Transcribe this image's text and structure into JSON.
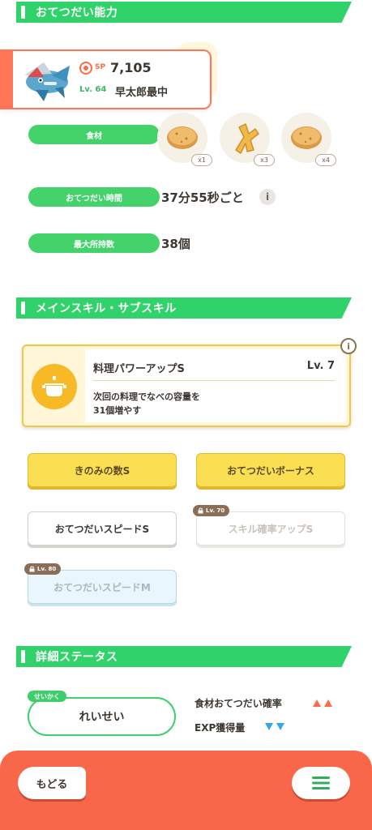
{
  "sections": {
    "ability": "おてつだい能力",
    "skills": "メインスキル・サブスキル",
    "status": "詳細ステータス"
  },
  "pokemon": {
    "sp_label": "SP",
    "sp_value": "7,105",
    "level": "Lv. 64",
    "nickname": "早太郎最中",
    "accent_color": "#ff7656"
  },
  "ability": {
    "ingredients_label": "食材",
    "ingredients": [
      {
        "icon": "potato-icon",
        "count": "x1"
      },
      {
        "icon": "ginger-icon",
        "count": "x3"
      },
      {
        "icon": "potato-icon",
        "count": "x4"
      }
    ],
    "help_time_label": "おてつだい時間",
    "help_time_value": "37分55秒ごと",
    "max_carry_label": "最大所持数",
    "max_carry_value": "38個"
  },
  "main_skill": {
    "name": "料理パワーアップS",
    "level": "Lv. 7",
    "description_line1": "次回の料理でなべの容量を",
    "description_line2": "31個増やす"
  },
  "sub_skills": [
    {
      "label": "きのみの数S",
      "style": "gold"
    },
    {
      "label": "おてつだいボーナス",
      "style": "gold"
    },
    {
      "label": "おてつだいスピードS",
      "style": "white"
    },
    {
      "label": "スキル確率アップS",
      "style": "disabled",
      "lock": "Lv. 70"
    },
    {
      "label": "おてつだいスピードM",
      "style": "blue",
      "lock": "Lv. 80"
    }
  ],
  "status": {
    "nature_tag": "せいかく",
    "nature_value": "れいせい",
    "up_stat_label": "食材おてつだい確率",
    "down_stat_label": "EXP獲得量",
    "up_color": "#ff6a45",
    "down_color": "#35a6e6"
  },
  "nav": {
    "back_label": "もどる",
    "menu_icon": "hamburger-menu-icon"
  },
  "colors": {
    "banner_green": "#2fd36a",
    "bottom_bar": "#f8674a",
    "skill_gold": "#fbdf52"
  }
}
